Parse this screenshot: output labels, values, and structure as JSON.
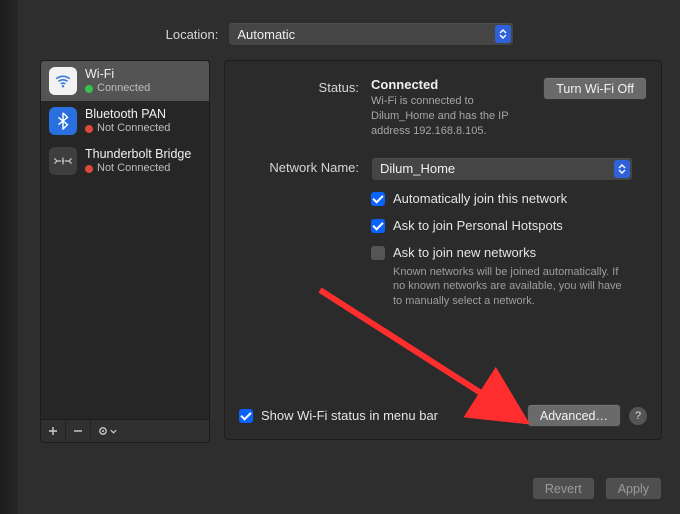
{
  "location": {
    "label": "Location:",
    "value": "Automatic"
  },
  "sidebar": {
    "items": [
      {
        "name": "Wi-Fi",
        "status": "Connected",
        "dot": "green",
        "iconKind": "wifi"
      },
      {
        "name": "Bluetooth PAN",
        "status": "Not Connected",
        "dot": "red",
        "iconKind": "bt"
      },
      {
        "name": "Thunderbolt Bridge",
        "status": "Not Connected",
        "dot": "red",
        "iconKind": "tb"
      }
    ],
    "toolbar": {
      "add": "+",
      "remove": "−",
      "more": "⦿"
    }
  },
  "detail": {
    "status_label": "Status:",
    "status_value": "Connected",
    "toggle_label": "Turn Wi-Fi Off",
    "status_desc": "Wi-Fi is connected to Dilum_Home and has the IP address 192.168.8.105.",
    "network_label": "Network Name:",
    "network_value": "Dilum_Home",
    "chk_auto": "Automatically join this network",
    "chk_hotspot": "Ask to join Personal Hotspots",
    "chk_ask": "Ask to join new networks",
    "chk_ask_sub": "Known networks will be joined automatically. If no known networks are available, you will have to manually select a network.",
    "menubar_label": "Show Wi-Fi status in menu bar",
    "advanced_label": "Advanced…",
    "help": "?"
  },
  "footer": {
    "revert": "Revert",
    "apply": "Apply"
  }
}
